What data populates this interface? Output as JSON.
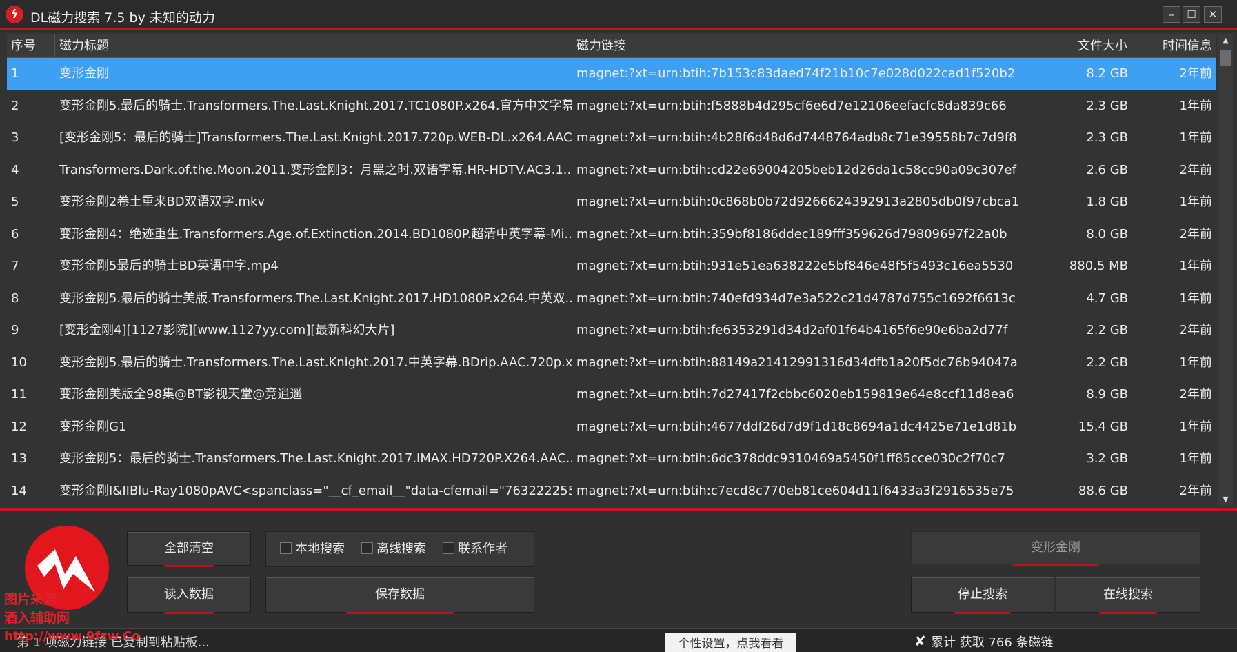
{
  "window": {
    "title": "DL磁力搜索 7.5 by 未知的动力",
    "min_glyph": "–",
    "max_glyph": "☐",
    "close_glyph": "✕"
  },
  "table": {
    "headers": {
      "index": "序号",
      "title": "磁力标题",
      "link": "磁力链接",
      "size": "文件大小",
      "time": "时间信息"
    },
    "rows": [
      {
        "index": "1",
        "title": "变形金刚",
        "link": "magnet:?xt=urn:btih:7b153c83daed74f21b10c7e028d022cad1f520b2",
        "size": "8.2 GB",
        "time": "2年前"
      },
      {
        "index": "2",
        "title": "变形金刚5.最后的骑士.Transformers.The.Last.Knight.2017.TC1080P.x264.官方中文字幕...",
        "link": "magnet:?xt=urn:btih:f5888b4d295cf6e6d7e12106eefacfc8da839c66",
        "size": "2.3 GB",
        "time": "1年前"
      },
      {
        "index": "3",
        "title": "[变形金刚5：最后的骑士]Transformers.The.Last.Knight.2017.720p.WEB-DL.x264.AAC-...",
        "link": "magnet:?xt=urn:btih:4b28f6d48d6d7448764adb8c71e39558b7c7d9f8",
        "size": "2.3 GB",
        "time": "1年前"
      },
      {
        "index": "4",
        "title": "Transformers.Dark.of.the.Moon.2011.变形金刚3：月黑之时.双语字幕.HR-HDTV.AC3.1...",
        "link": "magnet:?xt=urn:btih:cd22e69004205beb12d26da1c58cc90a09c307ef",
        "size": "2.6 GB",
        "time": "2年前"
      },
      {
        "index": "5",
        "title": "变形金刚2卷土重来BD双语双字.mkv",
        "link": "magnet:?xt=urn:btih:0c868b0b72d9266624392913a2805db0f97cbca1",
        "size": "1.8 GB",
        "time": "1年前"
      },
      {
        "index": "6",
        "title": "变形金刚4：绝迹重生.Transformers.Age.of.Extinction.2014.BD1080P.超清中英字幕-Mi...",
        "link": "magnet:?xt=urn:btih:359bf8186ddec189fff359626d79809697f22a0b",
        "size": "8.0 GB",
        "time": "2年前"
      },
      {
        "index": "7",
        "title": "变形金刚5最后的骑士BD英语中字.mp4",
        "link": "magnet:?xt=urn:btih:931e51ea638222e5bf846e48f5f5493c16ea5530",
        "size": "880.5 MB",
        "time": "1年前"
      },
      {
        "index": "8",
        "title": "变形金刚5.最后的骑士美版.Transformers.The.Last.Knight.2017.HD1080P.x264.中英双...",
        "link": "magnet:?xt=urn:btih:740efd934d7e3a522c21d4787d755c1692f6613c",
        "size": "4.7 GB",
        "time": "1年前"
      },
      {
        "index": "9",
        "title": "[变形金刚4][1127影院][www.1127yy.com][最新科幻大片]",
        "link": "magnet:?xt=urn:btih:fe6353291d34d2af01f64b4165f6e90e6ba2d77f",
        "size": "2.2 GB",
        "time": "2年前"
      },
      {
        "index": "10",
        "title": "变形金刚5.最后的骑士.Transformers.The.Last.Knight.2017.中英字幕.BDrip.AAC.720p.x...",
        "link": "magnet:?xt=urn:btih:88149a21412991316d34dfb1a20f5dc76b94047a",
        "size": "2.2 GB",
        "time": "1年前"
      },
      {
        "index": "11",
        "title": "变形金刚美版全98集@BT影视天堂@竞逍遥",
        "link": "magnet:?xt=urn:btih:7d27417f2cbbc6020eb159819e64e8ccf11d8ea6",
        "size": "8.9 GB",
        "time": "2年前"
      },
      {
        "index": "12",
        "title": "变形金刚G1",
        "link": "magnet:?xt=urn:btih:4677ddf26d7d9f1d18c8694a1dc4425e71e1d81b",
        "size": "15.4 GB",
        "time": "1年前"
      },
      {
        "index": "13",
        "title": "变形金刚5：最后的骑士.Transformers.The.Last.Knight.2017.IMAX.HD720P.X264.AAC....",
        "link": "magnet:?xt=urn:btih:6dc378ddc9310469a5450f1ff85cce030c2f70c7",
        "size": "3.2 GB",
        "time": "1年前"
      },
      {
        "index": "14",
        "title": "变形金刚I&IIBlu-Ray1080pAVC<spanclass=\"__cf_email__\"data-cfemail=\"763222255...",
        "link": "magnet:?xt=urn:btih:c7ecd8c770eb81ce604d11f6433a3f2916535e75",
        "size": "88.6 GB",
        "time": "2年前"
      }
    ],
    "selected_index": 0
  },
  "controls": {
    "clear_all": "全部清空",
    "load_data": "读入数据",
    "save_data": "保存数据",
    "local_search": "本地搜索",
    "offline_search": "离线搜索",
    "contact_author": "联系作者",
    "search_value": "变形金刚",
    "stop_search": "停止搜索",
    "online_search": "在线搜索"
  },
  "watermark": {
    "line1": "图片来源",
    "line2": "酒入辅助网",
    "line3": "http://www.9fzw.Co"
  },
  "status": {
    "left": "第 1 项磁力链接 已复制到粘贴板...",
    "personal_settings": "个性设置，点我看看",
    "x_glyph": "✘",
    "total": "累计 获取 766 条磁链"
  },
  "colors": {
    "accent_red": "#c0181d",
    "selected_row": "#3f9ff2",
    "background": "#2f2f2f"
  }
}
